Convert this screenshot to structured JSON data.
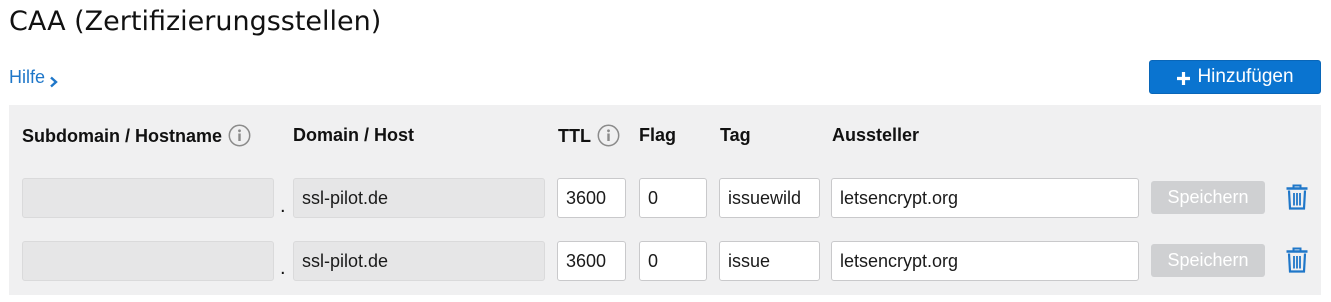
{
  "page": {
    "title": "CAA (Zertifizierungsstellen)",
    "help_label": "Hilfe",
    "add_label": "Hinzufügen"
  },
  "table": {
    "headers": {
      "subdomain": "Subdomain / Hostname",
      "domain": "Domain / Host",
      "ttl": "TTL",
      "flag": "Flag",
      "tag": "Tag",
      "issuer": "Aussteller"
    },
    "separator": ".",
    "save_label": "Speichern",
    "rows": [
      {
        "subdomain": "",
        "domain": "ssl-pilot.de",
        "ttl": "3600",
        "flag": "0",
        "tag": "issuewild",
        "issuer": "letsencrypt.org"
      },
      {
        "subdomain": "",
        "domain": "ssl-pilot.de",
        "ttl": "3600",
        "flag": "0",
        "tag": "issue",
        "issuer": "letsencrypt.org"
      }
    ]
  },
  "icons": {
    "help": "chevron-right-icon",
    "add": "plus-icon",
    "info": "info-icon",
    "delete": "trash-icon"
  },
  "colors": {
    "accent": "#0a74d0",
    "link": "#1f77c9",
    "panel": "#f0f0f1",
    "disabled_button": "#cfd0d2"
  }
}
